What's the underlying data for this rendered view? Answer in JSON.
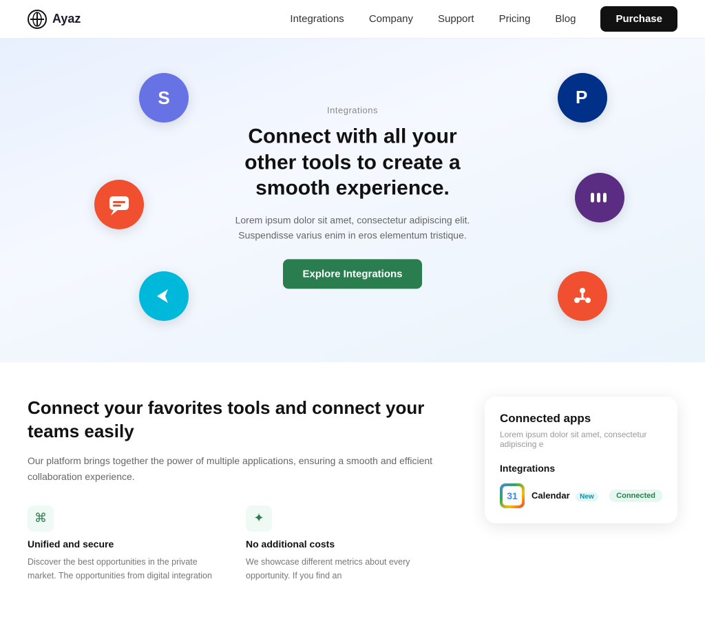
{
  "navbar": {
    "logo_text": "Ayaz",
    "links": [
      {
        "label": "Integrations",
        "href": "#"
      },
      {
        "label": "Company",
        "href": "#"
      },
      {
        "label": "Support",
        "href": "#"
      },
      {
        "label": "Pricing",
        "href": "#"
      },
      {
        "label": "Blog",
        "href": "#"
      }
    ],
    "purchase_btn": "Purchase"
  },
  "integrations_hero": {
    "section_label": "Integrations",
    "title": "Connect with all your other tools to create a smooth experience.",
    "description": "Lorem ipsum dolor sit amet, consectetur adipiscing elit. Suspendisse varius enim in eros elementum tristique.",
    "cta_btn": "Explore Integrations",
    "icons": [
      {
        "id": "stripe",
        "symbol": "S"
      },
      {
        "id": "paypal",
        "symbol": "P"
      },
      {
        "id": "chat",
        "symbol": "💬"
      },
      {
        "id": "miio",
        "symbol": "≡"
      },
      {
        "id": "wise",
        "symbol": "➤"
      },
      {
        "id": "hubspot",
        "symbol": "@"
      }
    ]
  },
  "lower_section": {
    "title": "Connect your favorites tools and connect your teams easily",
    "description": "Our platform brings together the power of multiple applications, ensuring a smooth and efficient collaboration experience.",
    "features": [
      {
        "icon": "⌘",
        "title": "Unified and secure",
        "description": "Discover the best opportunities in the private market. The opportunities from digital integration"
      },
      {
        "icon": "✦",
        "title": "No additional costs",
        "description": "We showcase different metrics about every opportunity. If you find an"
      }
    ]
  },
  "connected_card": {
    "title": "Connected apps",
    "description": "Lorem ipsum dolor sit amet, consectetur adipiscing e",
    "section_label": "Integrations",
    "integration": {
      "name": "Calendar",
      "badge": "New",
      "status": "Connected"
    }
  }
}
